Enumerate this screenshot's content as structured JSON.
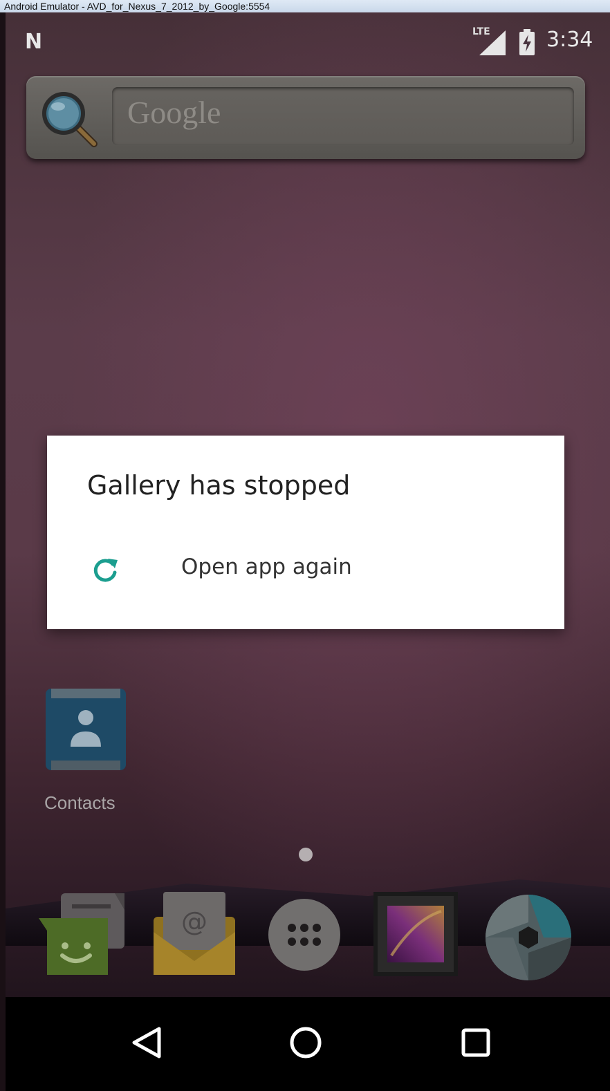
{
  "window": {
    "title": "Android Emulator - AVD_for_Nexus_7_2012_by_Google:5554"
  },
  "status_bar": {
    "network_label": "LTE",
    "time": "3:34",
    "icons": [
      "notification-n-icon",
      "lte-signal-icon",
      "battery-charging-icon"
    ]
  },
  "search_widget": {
    "placeholder": "Google",
    "icon": "search-icon"
  },
  "dialog": {
    "title": "Gallery has stopped",
    "action_label": "Open app again",
    "action_icon": "reload-icon",
    "accent_color": "#1b9e8f"
  },
  "home": {
    "apps": [
      {
        "label": "Contacts",
        "icon": "contacts-icon"
      }
    ]
  },
  "dock": {
    "icons": [
      "messages-icon",
      "email-icon",
      "app-launcher-icon",
      "gallery-icon",
      "camera-icon"
    ]
  },
  "nav_bar": {
    "icons": [
      "back-icon",
      "home-icon",
      "recents-icon"
    ]
  }
}
